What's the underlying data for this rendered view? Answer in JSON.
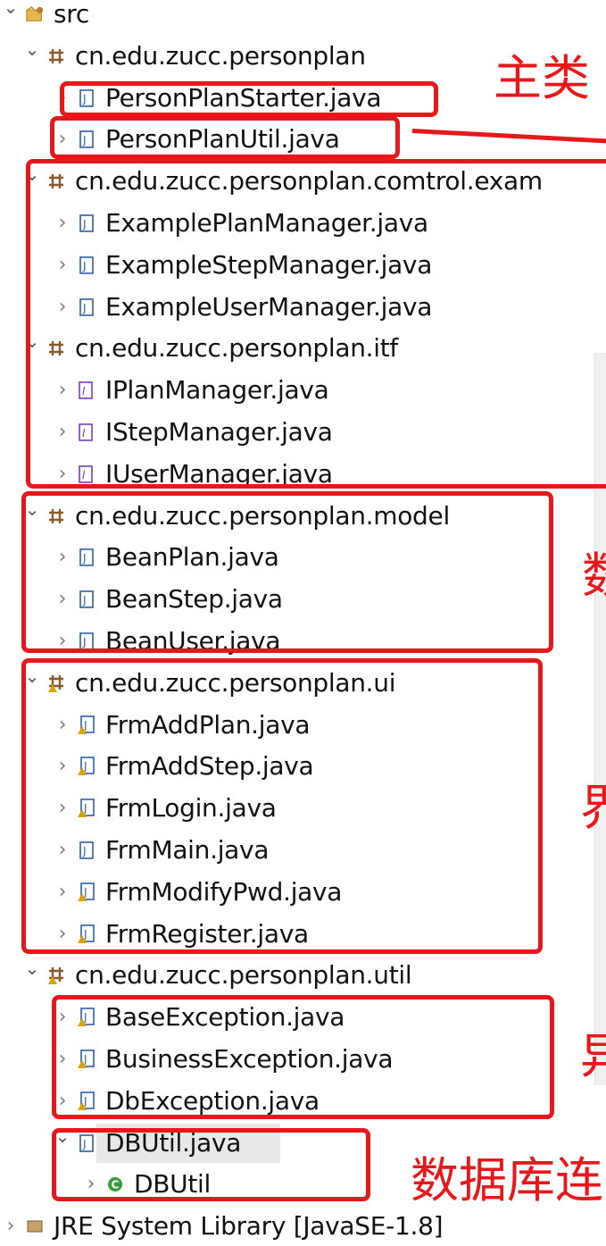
{
  "tree": {
    "rows": [
      {
        "label": "src",
        "kind": "src",
        "expanded": true
      },
      {
        "label": "cn.edu.zucc.personplan",
        "kind": "package",
        "expanded": true
      },
      {
        "label": "PersonPlanStarter.java",
        "kind": "java",
        "expanded": false
      },
      {
        "label": "PersonPlanUtil.java",
        "kind": "java",
        "expanded": false
      },
      {
        "label": "cn.edu.zucc.personplan.comtrol.exam",
        "kind": "package",
        "expanded": true
      },
      {
        "label": "ExamplePlanManager.java",
        "kind": "java",
        "expanded": false
      },
      {
        "label": "ExampleStepManager.java",
        "kind": "java",
        "expanded": false
      },
      {
        "label": "ExampleUserManager.java",
        "kind": "java",
        "expanded": false
      },
      {
        "label": "cn.edu.zucc.personplan.itf",
        "kind": "package",
        "expanded": true
      },
      {
        "label": "IPlanManager.java",
        "kind": "interface",
        "expanded": false
      },
      {
        "label": "IStepManager.java",
        "kind": "interface",
        "expanded": false
      },
      {
        "label": "IUserManager.java",
        "kind": "interface",
        "expanded": false
      },
      {
        "label": "cn.edu.zucc.personplan.model",
        "kind": "package",
        "expanded": true
      },
      {
        "label": "BeanPlan.java",
        "kind": "java",
        "expanded": false
      },
      {
        "label": "BeanStep.java",
        "kind": "java",
        "expanded": false
      },
      {
        "label": "BeanUser.java",
        "kind": "java",
        "expanded": false
      },
      {
        "label": "cn.edu.zucc.personplan.ui",
        "kind": "package-warn",
        "expanded": true
      },
      {
        "label": "FrmAddPlan.java",
        "kind": "java-warn",
        "expanded": false
      },
      {
        "label": "FrmAddStep.java",
        "kind": "java-warn",
        "expanded": false
      },
      {
        "label": "FrmLogin.java",
        "kind": "java-warn",
        "expanded": false
      },
      {
        "label": "FrmMain.java",
        "kind": "java",
        "expanded": false
      },
      {
        "label": "FrmModifyPwd.java",
        "kind": "java-warn",
        "expanded": false
      },
      {
        "label": "FrmRegister.java",
        "kind": "java-warn",
        "expanded": false
      },
      {
        "label": "cn.edu.zucc.personplan.util",
        "kind": "package-warn",
        "expanded": true
      },
      {
        "label": "BaseException.java",
        "kind": "java-warn",
        "expanded": false
      },
      {
        "label": "BusinessException.java",
        "kind": "java-warn",
        "expanded": false
      },
      {
        "label": "DbException.java",
        "kind": "java-warn",
        "expanded": false
      },
      {
        "label": "DBUtil.java",
        "kind": "java",
        "expanded": true,
        "selected": true
      },
      {
        "label": "DBUtil",
        "kind": "class",
        "expanded": false
      },
      {
        "label": "JRE System Library [JavaSE-1.8]",
        "kind": "library",
        "expanded": false
      }
    ]
  },
  "annotations": {
    "main_class": "主类",
    "data": "数",
    "ui": "界",
    "exception": "异",
    "database": "数据库连"
  },
  "colors": {
    "annotation_red": "#e8171a",
    "package_brown": "#8a5a2b",
    "java_blue": "#2f5fa8",
    "interface_purple": "#7a3fb0",
    "class_green": "#3a9a3a",
    "warn_yellow": "#d9a400"
  }
}
